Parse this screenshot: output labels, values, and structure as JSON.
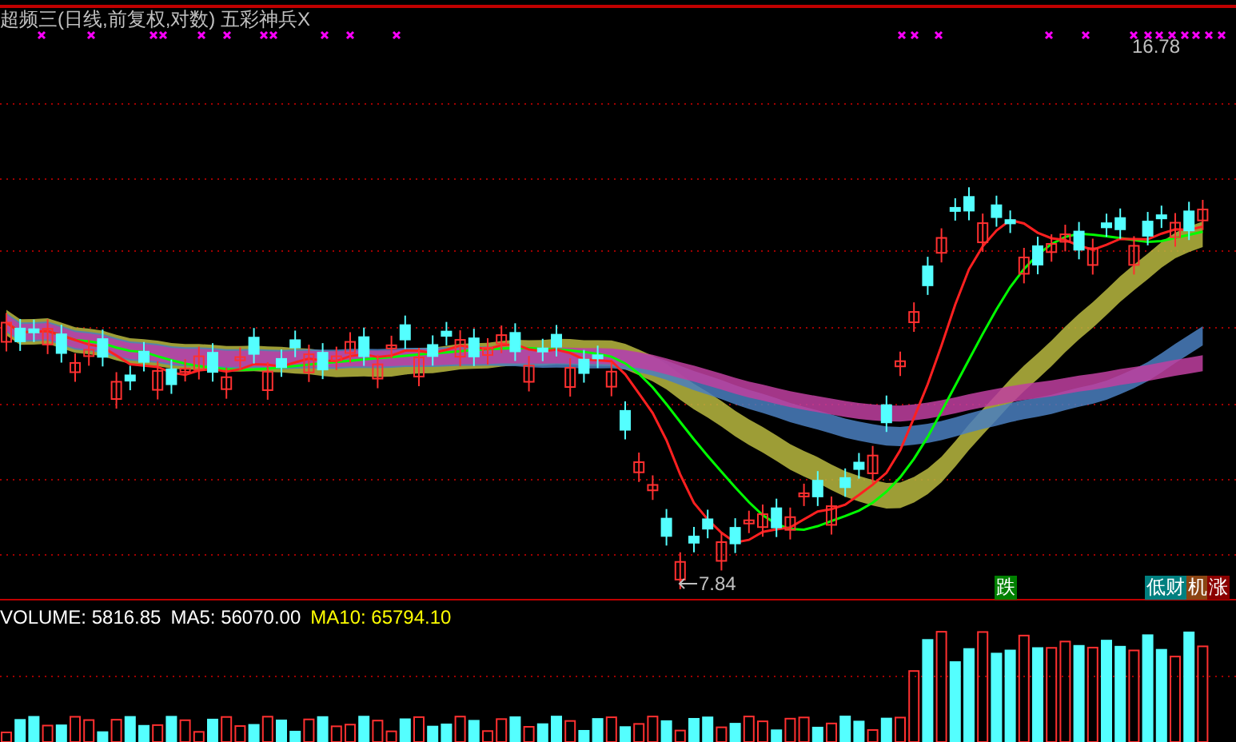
{
  "title": "超频三(日线,前复权,对数) 五彩神兵X",
  "price_labels": [
    {
      "kind": "high",
      "text": "16.78"
    },
    {
      "kind": "low",
      "text": "7.84"
    }
  ],
  "signals": [
    {
      "text": "跌",
      "color": "#008000"
    },
    {
      "text": "低财",
      "color": "#008080"
    },
    {
      "text": "机",
      "color": "#8b4513"
    },
    {
      "text": "涨",
      "color": "#8b0000"
    }
  ],
  "volume_legend": [
    {
      "text": "VOLUME: 5816.85",
      "color": "#ffffff"
    },
    {
      "text": "MA5: 56070.00",
      "color": "#ffffff"
    },
    {
      "text": "MA10: 65794.10",
      "color": "#ffff00"
    }
  ]
}
